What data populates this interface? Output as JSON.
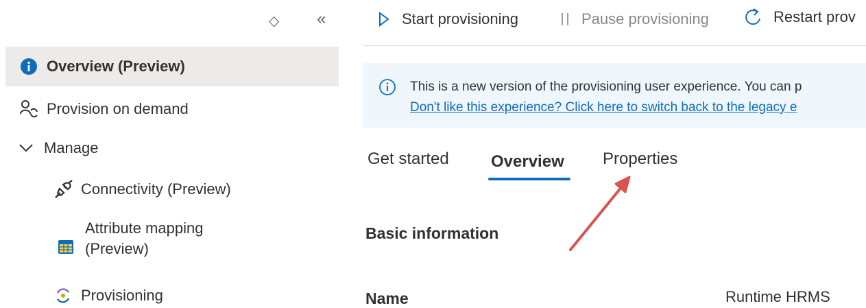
{
  "sidebar": {
    "sort_icon": "◇",
    "collapse_icon": "«",
    "items": [
      {
        "label": "Overview (Preview)",
        "icon": "info-icon",
        "selected": true
      },
      {
        "label": "Provision on demand",
        "icon": "user-sync-icon"
      },
      {
        "label": "Manage",
        "icon": "chevron-down-icon"
      },
      {
        "label": "Connectivity (Preview)",
        "icon": "plug-icon"
      },
      {
        "label_line1": "Attribute mapping",
        "label_line2": "(Preview)",
        "icon": "table-icon"
      },
      {
        "label": "Provisioning",
        "icon": "cycle-icon"
      }
    ]
  },
  "toolbar": {
    "start_label": "Start provisioning",
    "pause_label": "Pause provisioning",
    "restart_label": "Restart prov"
  },
  "banner": {
    "text": "This is a new version of the provisioning user experience. You can p",
    "link": "Don't like this experience? Click here to switch back to the legacy e"
  },
  "tabs": [
    {
      "label": "Get started"
    },
    {
      "label": "Overview",
      "active": true
    },
    {
      "label": "Properties"
    }
  ],
  "content": {
    "section_title": "Basic information",
    "name_label": "Name",
    "name_value": "Runtime HRMS"
  },
  "colors": {
    "accent": "#0f6cbd",
    "selected_bg": "#edebe9",
    "banner_bg": "#eff6fc",
    "annotation_arrow": "#d9534f"
  }
}
